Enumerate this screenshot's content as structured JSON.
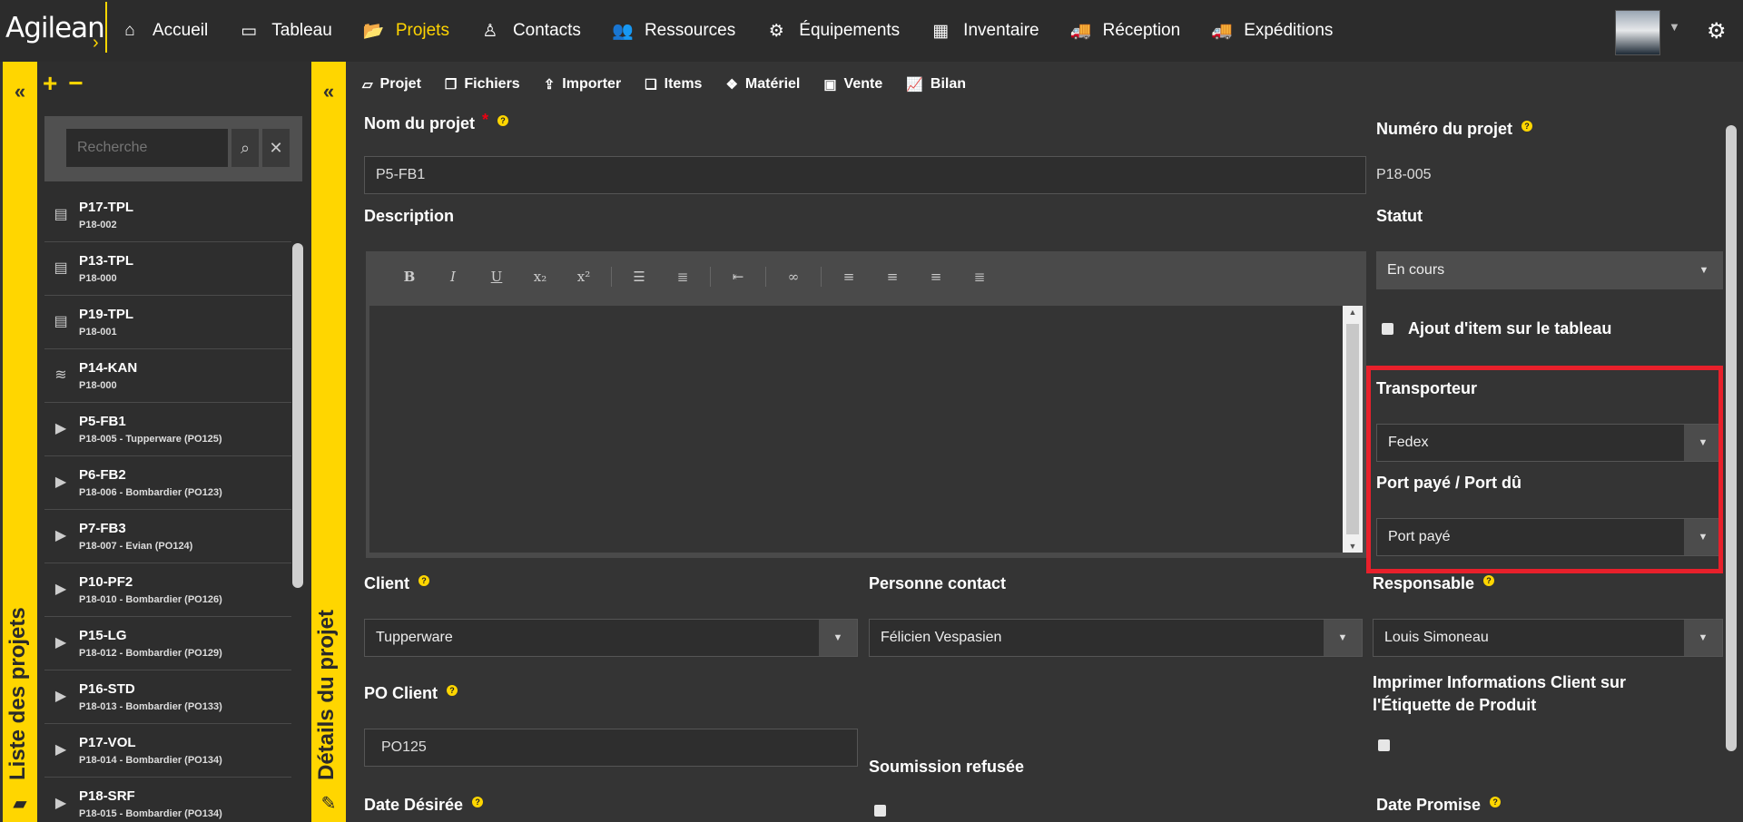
{
  "app": {
    "logo": "Agilean"
  },
  "nav": [
    {
      "icon": "home-icon",
      "glyph": "⌂",
      "label": "Accueil"
    },
    {
      "icon": "monitor-icon",
      "glyph": "▭",
      "label": "Tableau"
    },
    {
      "icon": "folder-open-icon",
      "glyph": "📂",
      "label": "Projets",
      "active": true
    },
    {
      "icon": "person-icon",
      "glyph": "♙",
      "label": "Contacts"
    },
    {
      "icon": "users-icon",
      "glyph": "👥",
      "label": "Ressources"
    },
    {
      "icon": "cogs-icon",
      "glyph": "⚙",
      "label": "Équipements"
    },
    {
      "icon": "grid-icon",
      "glyph": "▦",
      "label": "Inventaire"
    },
    {
      "icon": "truck-icon",
      "glyph": "🚚",
      "label": "Réception"
    },
    {
      "icon": "truck-icon",
      "glyph": "🚚",
      "label": "Expéditions"
    }
  ],
  "sidebar": {
    "label": "Liste des projets",
    "search_placeholder": "Recherche",
    "items": [
      {
        "icon": "barcode-icon",
        "glyph": "▤",
        "name": "P17-TPL",
        "sub": "P18-002"
      },
      {
        "icon": "barcode-icon",
        "glyph": "▤",
        "name": "P13-TPL",
        "sub": "P18-000"
      },
      {
        "icon": "barcode-icon",
        "glyph": "▤",
        "name": "P19-TPL",
        "sub": "P18-001"
      },
      {
        "icon": "database-icon",
        "glyph": "≋",
        "name": "P14-KAN",
        "sub": "P18-000"
      },
      {
        "icon": "play-icon",
        "glyph": "▶",
        "name": "P5-FB1",
        "sub": "P18-005 - Tupperware (PO125)"
      },
      {
        "icon": "play-icon",
        "glyph": "▶",
        "name": "P6-FB2",
        "sub": "P18-006 - Bombardier (PO123)"
      },
      {
        "icon": "play-icon",
        "glyph": "▶",
        "name": "P7-FB3",
        "sub": "P18-007 - Evian (PO124)"
      },
      {
        "icon": "play-icon",
        "glyph": "▶",
        "name": "P10-PF2",
        "sub": "P18-010 - Bombardier (PO126)"
      },
      {
        "icon": "play-icon",
        "glyph": "▶",
        "name": "P15-LG",
        "sub": "P18-012 - Bombardier (PO129)"
      },
      {
        "icon": "play-icon",
        "glyph": "▶",
        "name": "P16-STD",
        "sub": "P18-013 - Bombardier (PO133)"
      },
      {
        "icon": "play-icon",
        "glyph": "▶",
        "name": "P17-VOL",
        "sub": "P18-014 - Bombardier (PO134)"
      },
      {
        "icon": "play-icon",
        "glyph": "▶",
        "name": "P18-SRF",
        "sub": "P18-015 - Bombardier (PO134)"
      }
    ]
  },
  "details": {
    "label": "Détails du projet",
    "tabs": [
      {
        "icon": "inbox-icon",
        "glyph": "▱",
        "label": "Projet"
      },
      {
        "icon": "files-icon",
        "glyph": "❐",
        "label": "Fichiers"
      },
      {
        "icon": "upload-icon",
        "glyph": "⇪",
        "label": "Importer"
      },
      {
        "icon": "copy-icon",
        "glyph": "❏",
        "label": "Items"
      },
      {
        "icon": "cubes-icon",
        "glyph": "❖",
        "label": "Matériel"
      },
      {
        "icon": "money-icon",
        "glyph": "▣",
        "label": "Vente"
      },
      {
        "icon": "chart-line-icon",
        "glyph": "📈",
        "label": "Bilan"
      }
    ],
    "project_name_label": "Nom du projet",
    "project_name_value": "P5-FB1",
    "description_label": "Description",
    "project_number_label": "Numéro du projet",
    "project_number_value": "P18-005",
    "status_label": "Statut",
    "status_value": "En cours",
    "add_item_label": "Ajout d'item sur le tableau",
    "carrier_label": "Transporteur",
    "carrier_value": "Fedex",
    "freight_label": "Port payé / Port dû",
    "freight_value": "Port payé",
    "client_label": "Client",
    "client_value": "Tupperware",
    "contact_label": "Personne contact",
    "contact_value": "Félicien Vespasien",
    "manager_label": "Responsable",
    "manager_value": "Louis Simoneau",
    "po_label": "PO Client",
    "po_value": "PO125",
    "rejected_label": "Soumission refusée",
    "print_label_line1": "Imprimer Informations Client sur",
    "print_label_line2": "l'Étiquette de Produit",
    "desired_date_label": "Date Désirée",
    "promised_date_label": "Date Promise"
  },
  "colors": {
    "accent": "#ffd600",
    "highlight": "#e8202b"
  }
}
